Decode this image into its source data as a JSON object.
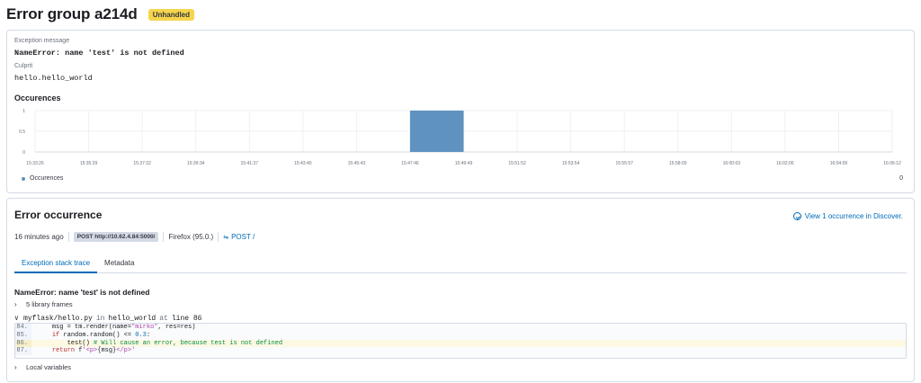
{
  "header": {
    "title": "Error group a214d",
    "badge": "Unhandled"
  },
  "summary": {
    "exception_label": "Exception message",
    "exception_value": "NameError: name 'test' is not defined",
    "culprit_label": "Culprit",
    "culprit_value": "hello.hello_world",
    "occurrences_title": "Occurences",
    "legend_label": "Occurences",
    "legend_count": "0"
  },
  "chart_data": {
    "type": "bar",
    "categories": [
      "15:33:26",
      "15:35:29",
      "15:37:32",
      "15:39:34",
      "15:41:37",
      "15:43:40",
      "15:45:43",
      "15:47:46",
      "15:49:49",
      "15:51:52",
      "15:53:54",
      "15:55:57",
      "15:58:00",
      "16:00:03",
      "16:02:06",
      "16:04:09",
      "16:06:12"
    ],
    "bars": [
      {
        "start": "15:47:46",
        "end": "15:49:49",
        "value": 1
      }
    ],
    "yticks": [
      "1",
      "0.5",
      "0"
    ],
    "ylim": [
      0,
      1
    ],
    "grid": true,
    "color": "#6092c0"
  },
  "occurrence": {
    "title": "Error occurrence",
    "discover_link": "View 1 occurrence in Discover.",
    "time_ago": "16 minutes ago",
    "request_url": "POST http://10.62.4.84:5000/",
    "browser": "Firefox (95.0.)",
    "request_method": "POST /",
    "tabs": [
      {
        "label": "Exception stack trace"
      },
      {
        "label": "Metadata"
      }
    ],
    "exception_heading": "NameError: name 'test' is not defined",
    "library_frames": "5 library frames",
    "file_path": "myflask/hello.py",
    "in_word": "in",
    "function_name": "hello_world",
    "at_word": "at",
    "line_word": "line 86",
    "code_lines": [
      {
        "num": "84.",
        "indent": "    ",
        "parts": [
          {
            "t": "msg = tm.render(name=",
            "c": ""
          },
          {
            "t": "\"mirko\"",
            "c": "str"
          },
          {
            "t": ", res=res)",
            "c": ""
          }
        ]
      },
      {
        "num": "85.",
        "indent": "    ",
        "parts": [
          {
            "t": "if",
            "c": "kw"
          },
          {
            "t": " random.random() <= ",
            "c": ""
          },
          {
            "t": "0.3",
            "c": "num"
          },
          {
            "t": ":",
            "c": ""
          }
        ]
      },
      {
        "num": "86.",
        "indent": "        ",
        "highlight": true,
        "parts": [
          {
            "t": "test() ",
            "c": ""
          },
          {
            "t": "# Will cause an error, because test is not defined",
            "c": "cmt"
          }
        ]
      },
      {
        "num": "87.",
        "indent": "    ",
        "parts": [
          {
            "t": "return",
            "c": "kw"
          },
          {
            "t": " f",
            "c": ""
          },
          {
            "t": "'<p>",
            "c": "str"
          },
          {
            "t": "{msg}",
            "c": ""
          },
          {
            "t": "</p>'",
            "c": "str"
          }
        ]
      }
    ],
    "local_variables": "Local variables"
  },
  "colors": {
    "accent": "#006bb8",
    "badge": "#f5d54c",
    "bar": "#6092c0"
  },
  "icons": {
    "discover": "discover-icon",
    "request": "link-icon",
    "chevron_right": "chevron-right-icon",
    "chevron_down": "chevron-down-icon"
  }
}
